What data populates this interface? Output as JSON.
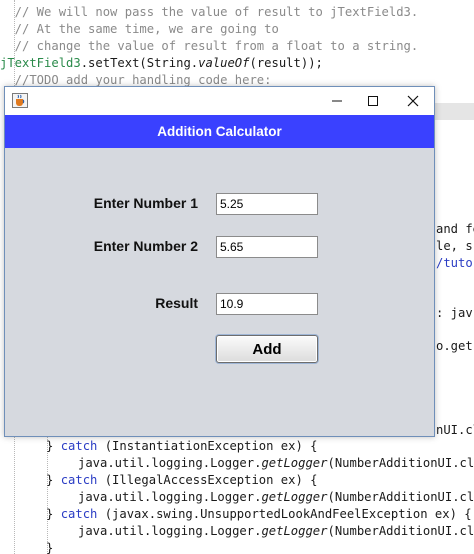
{
  "editor": {
    "top_lines": [
      {
        "text": "  // We will now pass the value of result to jTextField3.",
        "kind": "comment"
      },
      {
        "text": "  // At the same time, we are going to",
        "kind": "comment"
      },
      {
        "text": "  // change the value of result from a float to a string.",
        "kind": "comment"
      }
    ],
    "settext_line": {
      "ident": "jTextField3",
      "mid": ".setText(String.",
      "method": "valueOf",
      "tail": "(result));"
    },
    "todo_line": "  //TODO add your handling code here:",
    "right_fragments": [
      "and fe",
      "le, s",
      "/tuto",
      ": jav",
      "o.get(",
      "nUI.cl"
    ],
    "catch_lines": [
      {
        "keyword": "catch",
        "rest": " (InstantiationException ex) {"
      },
      {
        "keyword": "catch",
        "rest": " (IllegalAccessException ex) {"
      },
      {
        "keyword": "catch",
        "rest": " (javax.swing.UnsupportedLookAndFeelException ex) {"
      }
    ],
    "logger_prefix": "java.util.logging.Logger.",
    "logger_method": "getLogger",
    "logger_suffix": "(NumberAdditionUI.cl"
  },
  "window": {
    "icons": {
      "app": "java-cup-icon",
      "minimize": "minimize-icon",
      "maximize": "maximize-icon",
      "close": "close-icon"
    },
    "header_title": "Addition Calculator",
    "header_color": "#3a41ff",
    "label_number1": "Enter Number 1",
    "value_number1": "5.25",
    "label_number2": "Enter Number 2",
    "value_number2": "5.65",
    "label_result": "Result",
    "value_result": "10.9",
    "add_label": "Add"
  }
}
